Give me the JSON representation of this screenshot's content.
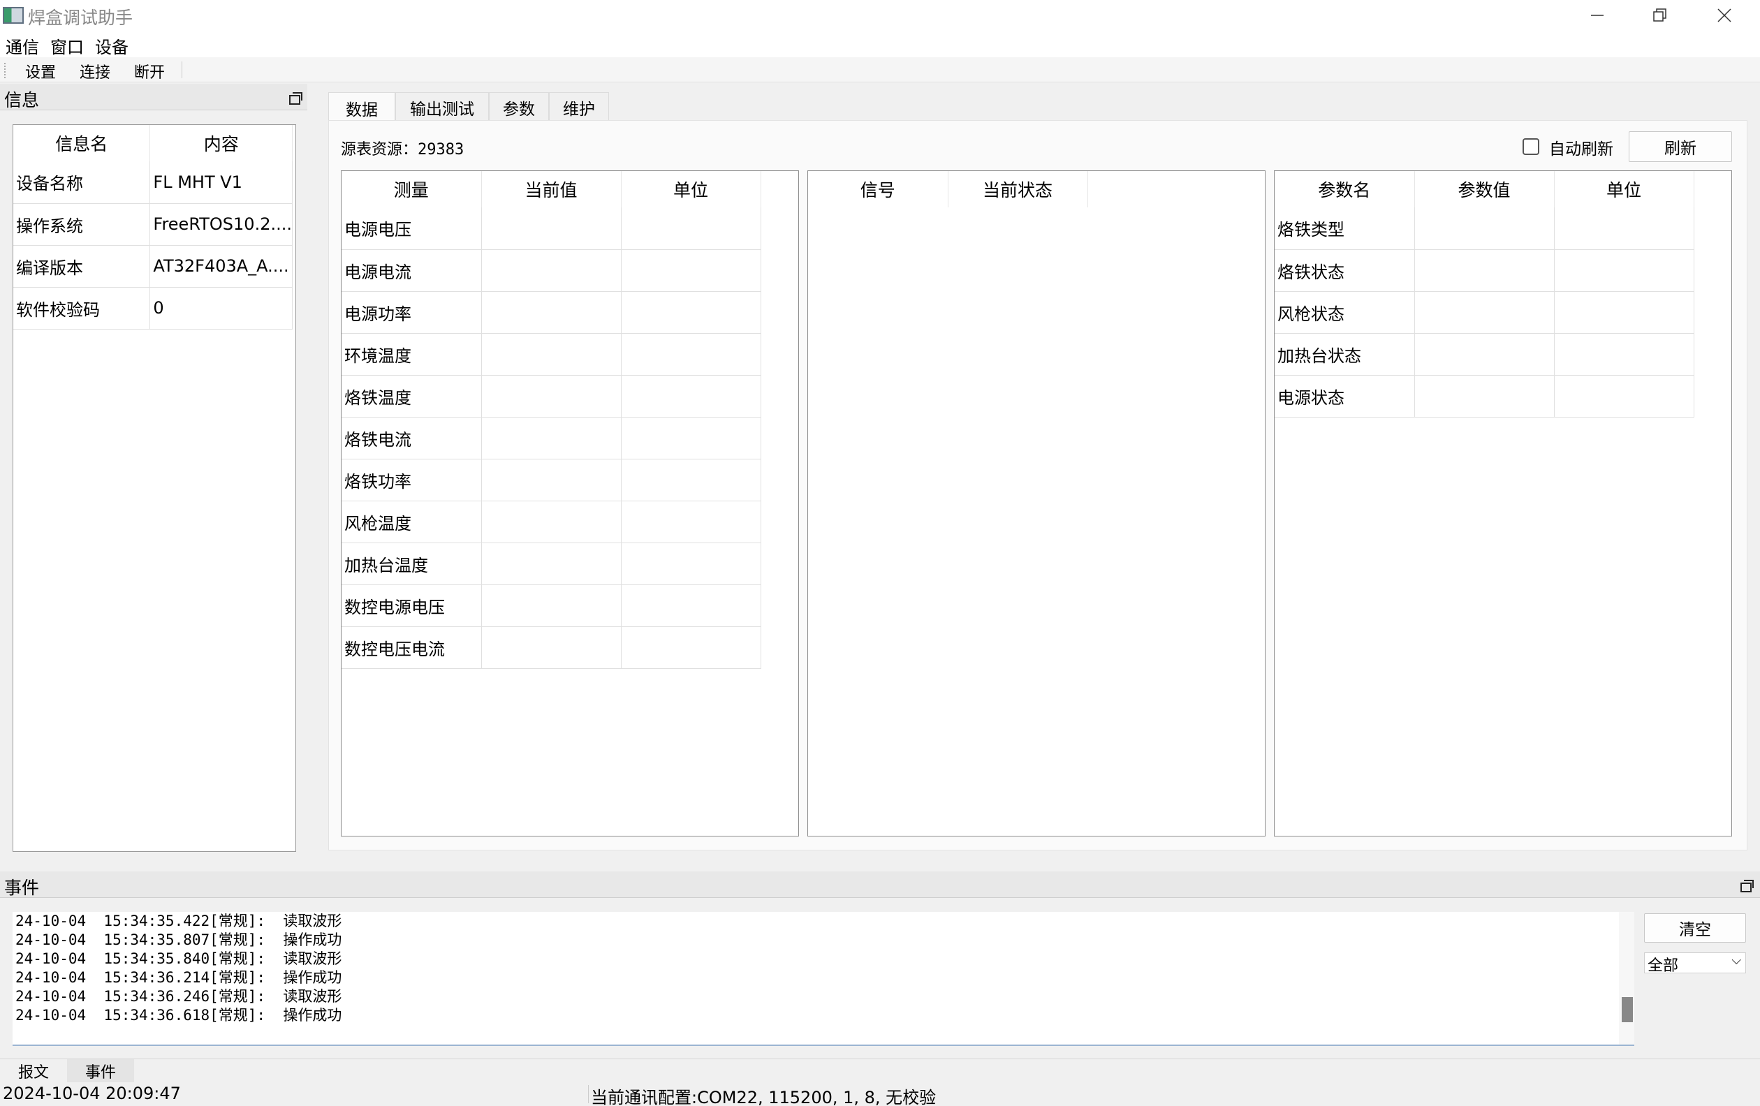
{
  "window": {
    "title": "焊盒调试助手"
  },
  "menu": {
    "items": [
      "通信",
      "窗口",
      "设备"
    ]
  },
  "toolbar": {
    "items": [
      "设置",
      "连接",
      "断开"
    ]
  },
  "info_dock": {
    "title": "信息",
    "headers": [
      "信息名",
      "内容"
    ],
    "rows": [
      [
        "设备名称",
        "FL MHT V1"
      ],
      [
        "操作系统",
        "FreeRTOS10.2...."
      ],
      [
        "编译版本",
        "AT32F403A_A...."
      ],
      [
        "软件校验码",
        "0"
      ]
    ]
  },
  "tabs": [
    "数据",
    "输出测试",
    "参数",
    "维护"
  ],
  "data_tab": {
    "source_label": "源表资源：29383",
    "auto_refresh_label": "自动刷新",
    "refresh_button": "刷新",
    "measure_table": {
      "headers": [
        "测量",
        "当前值",
        "单位"
      ],
      "rows": [
        "电源电压",
        "电源电流",
        "电源功率",
        "环境温度",
        "烙铁温度",
        "烙铁电流",
        "烙铁功率",
        "风枪温度",
        "加热台温度",
        "数控电源电压",
        "数控电压电流"
      ]
    },
    "signal_table": {
      "headers": [
        "信号",
        "当前状态"
      ]
    },
    "param_table": {
      "headers": [
        "参数名",
        "参数值",
        "单位"
      ],
      "rows": [
        "烙铁类型",
        "烙铁状态",
        "风枪状态",
        "加热台状态",
        "电源状态"
      ]
    }
  },
  "event_dock": {
    "title": "事件",
    "log": [
      "24-10-04  15:34:35.422[常规]:  读取波形",
      "24-10-04  15:34:35.807[常规]:  操作成功",
      "24-10-04  15:34:35.840[常规]:  读取波形",
      "24-10-04  15:34:36.214[常规]:  操作成功",
      "24-10-04  15:34:36.246[常规]:  读取波形",
      "24-10-04  15:34:36.618[常规]:  操作成功"
    ],
    "clear_button": "清空",
    "filter_value": "全部"
  },
  "bottom_tabs": [
    "报文",
    "事件"
  ],
  "status": {
    "datetime": "2024-10-04 20:09:47",
    "comm_config": "当前通讯配置:COM22, 115200, 1, 8, 无校验"
  },
  "icons": {
    "minimize": "minimize-icon",
    "maximize": "maximize-icon",
    "close": "close-icon",
    "float": "float-dock-icon",
    "dropdown": "chevron-down-icon"
  }
}
